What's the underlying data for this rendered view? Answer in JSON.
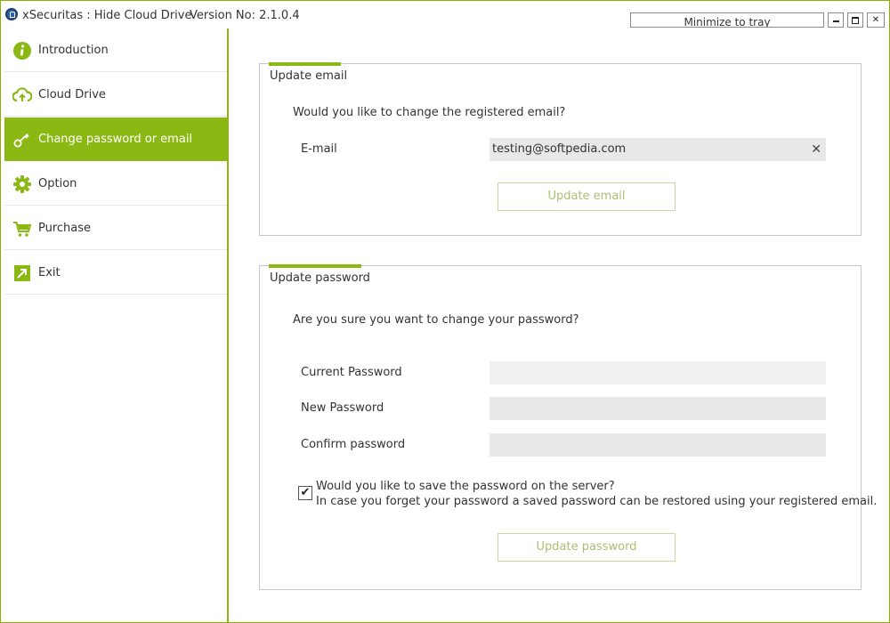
{
  "titlebar": {
    "app_title": "xSecuritas : Hide Cloud Drive",
    "version": "Version No: 2.1.0.4",
    "tray_button": "Minimize to tray",
    "close_glyph": "✕"
  },
  "sidebar": {
    "items": [
      {
        "label": "Introduction",
        "icon": "info-icon"
      },
      {
        "label": "Cloud Drive",
        "icon": "cloud-icon"
      },
      {
        "label": "Change password or email",
        "icon": "key-icon",
        "active": true
      },
      {
        "label": "Option",
        "icon": "gear-icon"
      },
      {
        "label": "Purchase",
        "icon": "cart-icon"
      },
      {
        "label": "Exit",
        "icon": "exit-icon"
      }
    ]
  },
  "email_section": {
    "title": "Update email",
    "question": "Would you like to change the registered email?",
    "email_label": "E-mail",
    "email_value": "testing@softpedia.com",
    "clear_glyph": "✕",
    "button": "Update email"
  },
  "password_section": {
    "title": "Update password",
    "question": "Are you sure you want to change your password?",
    "current_label": "Current Password",
    "new_label": "New Password",
    "confirm_label": "Confirm password",
    "save_question": "Would you like to save the password on the server?",
    "save_note": "In case you forget your password a saved password can be restored using your registered email.",
    "save_checked": true,
    "check_glyph": "✔",
    "button": "Update password"
  },
  "colors": {
    "accent": "#8cb814",
    "button_text": "#a9c072",
    "field_bg": "#e8e8e8"
  }
}
